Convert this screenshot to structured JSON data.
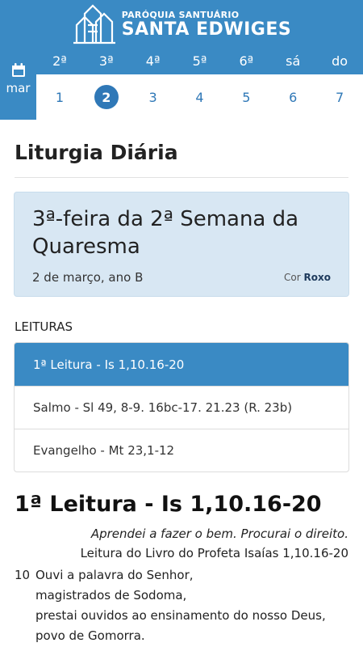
{
  "header": {
    "logo_small": "PARÓQUIA SANTUÁRIO",
    "logo_big": "SANTA EDWIGES"
  },
  "calendar": {
    "month": "mar",
    "weekdays": [
      "2ª",
      "3ª",
      "4ª",
      "5ª",
      "6ª",
      "sá",
      "do"
    ],
    "days": [
      "1",
      "2",
      "3",
      "4",
      "5",
      "6",
      "7"
    ],
    "selected_index": 1
  },
  "page_title": "Liturgia Diária",
  "day": {
    "title": "3ª-feira da 2ª Semana da Quaresma",
    "date": "2 de março, ano B",
    "color_label": "Cor",
    "color_value": "Roxo"
  },
  "readings": {
    "label": "LEITURAS",
    "items": [
      "1ª Leitura - Is 1,10.16-20",
      "Salmo - Sl 49, 8-9. 16bc-17. 21.23 (R. 23b)",
      "Evangelho - Mt 23,1-12"
    ],
    "active_index": 0
  },
  "reading": {
    "title": "1ª Leitura - Is 1,10.16-20",
    "quote": "Aprendei a fazer o bem. Procurai o direito.",
    "source": "Leitura do Livro do Profeta Isaías 1,10.16-20",
    "verse_number": "10",
    "lines": [
      "Ouvi a palavra do Senhor,",
      "magistrados de Sodoma,",
      "prestai ouvidos ao ensinamento do nosso Deus,",
      "povo de Gomorra."
    ]
  },
  "colors": {
    "primary": "#3a8ac4",
    "accent": "#2f78b7",
    "card_bg": "#d8e7f3"
  }
}
